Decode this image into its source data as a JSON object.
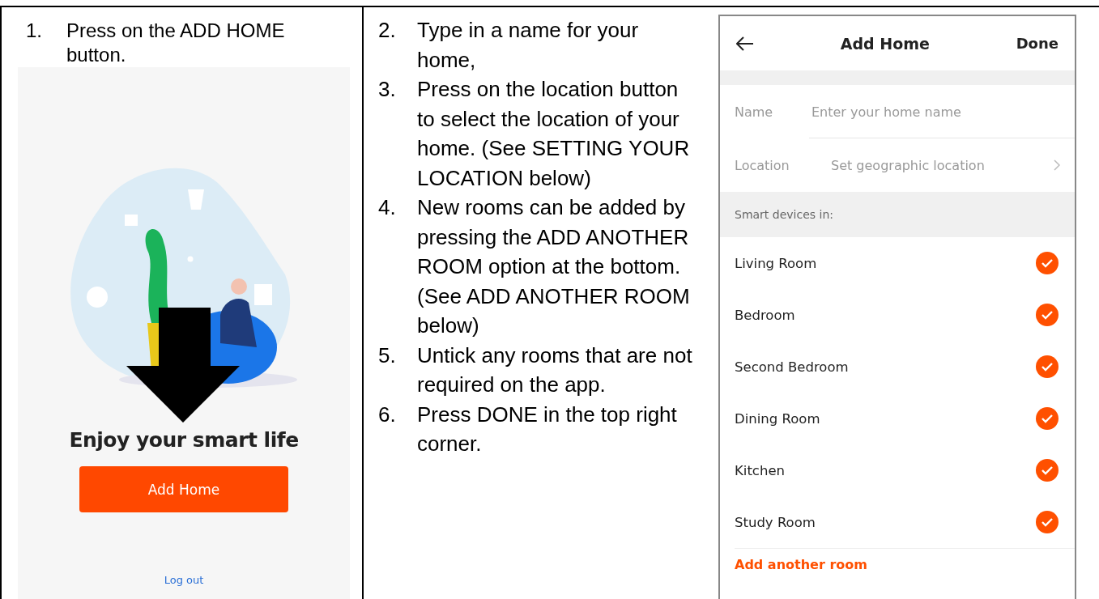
{
  "step_one": {
    "number": "1.",
    "text": "Press on the ADD HOME button."
  },
  "welcome_screen": {
    "title": "Enjoy your smart life",
    "button": "Add Home",
    "link": "Log out"
  },
  "steps": [
    {
      "number": "2.",
      "text": "Type in a name for your home,"
    },
    {
      "number": "3.",
      "text": "Press on the location button to select the location of your home.  (See SETTING YOUR LOCATION below)"
    },
    {
      "number": "4.",
      "text": "New rooms can be added by pressing the ADD ANOTHER ROOM option at the bottom. (See ADD ANOTHER ROOM below)"
    },
    {
      "number": "5.",
      "text": "Untick any rooms that are not required on the app."
    },
    {
      "number": "6.",
      "text": "Press DONE in the top right corner."
    }
  ],
  "add_home_screen": {
    "title": "Add Home",
    "action": "Done",
    "fields": [
      {
        "label": "Name",
        "placeholder": "Enter your home name"
      },
      {
        "label": "Location",
        "placeholder": "Set geographic location"
      }
    ],
    "section": "Smart devices in:",
    "rooms": [
      {
        "name": "Living Room",
        "checked": true
      },
      {
        "name": "Bedroom",
        "checked": true
      },
      {
        "name": "Second Bedroom",
        "checked": true
      },
      {
        "name": "Dining Room",
        "checked": true
      },
      {
        "name": "Kitchen",
        "checked": true
      },
      {
        "name": "Study Room",
        "checked": true
      }
    ],
    "add_room": "Add another room"
  }
}
